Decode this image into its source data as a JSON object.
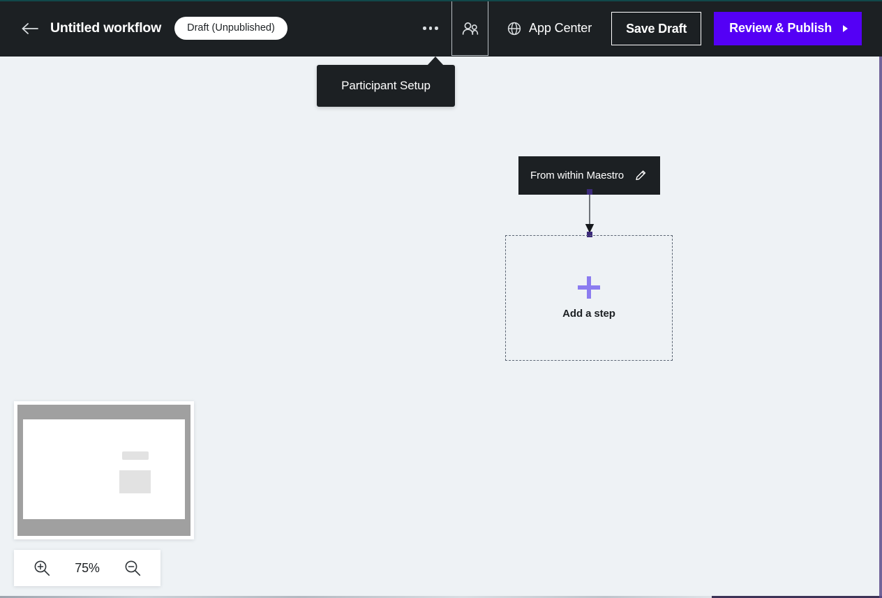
{
  "header": {
    "back_icon": "arrow-left-icon",
    "workflow_title": "Untitled workflow",
    "status_badge": "Draft (Unpublished)",
    "kebab_icon": "more-options-icon",
    "participant_icon": "participants-icon",
    "app_center_icon": "globe-icon",
    "app_center_label": "App Center",
    "save_draft_label": "Save Draft",
    "publish_label": "Review & Publish",
    "publish_caret_icon": "caret-right-icon",
    "background_color": "#1c2023",
    "accent_color": "#5400f5",
    "top_line_color": "#11484a"
  },
  "tooltip": {
    "text": "Participant Setup",
    "background_color": "#1c2023"
  },
  "canvas": {
    "background_color": "#eef2f5",
    "node": {
      "label": "From within Maestro",
      "edit_icon": "pencil-icon",
      "background_color": "#1c2023"
    },
    "connector": {
      "dot_color": "#3b2a7a",
      "line_color": "#2b3038",
      "arrow_icon": "arrow-down-icon"
    },
    "drop_zone": {
      "plus_icon": "plus-icon",
      "label": "Add a step",
      "border_color": "#5a6472",
      "plus_color": "#8b7cf0"
    }
  },
  "minimap": {
    "name": "canvas-minimap",
    "frame_color": "#a0a0a0",
    "viewport_color": "#ffffff",
    "node_color": "#e2e2e2"
  },
  "zoom_controls": {
    "zoom_in_icon": "zoom-in-icon",
    "zoom_out_icon": "zoom-out-icon",
    "level": "75%"
  }
}
